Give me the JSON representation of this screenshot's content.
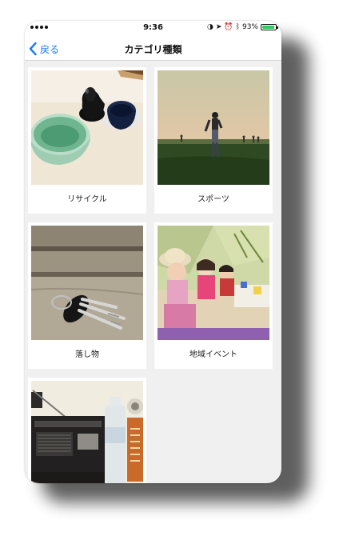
{
  "status_bar": {
    "time": "9:36",
    "battery": "93%",
    "battery_level": 0.93,
    "icons": [
      "signal-dots-icon",
      "lock-rotation-icon",
      "location-arrow-icon",
      "alarm-icon",
      "bluetooth-icon",
      "battery-icon"
    ]
  },
  "nav": {
    "back_label": "戻る",
    "title": "カテゴリ種類",
    "accent": "#1a7cf5"
  },
  "categories": [
    {
      "label": "リサイクル",
      "image": "cups-photo"
    },
    {
      "label": "スポーツ",
      "image": "field-player-photo"
    },
    {
      "label": "落し物",
      "image": "keys-photo"
    },
    {
      "label": "地域イベント",
      "image": "children-picnic-photo"
    },
    {
      "label": "",
      "image": "radio-bottle-photo"
    }
  ]
}
